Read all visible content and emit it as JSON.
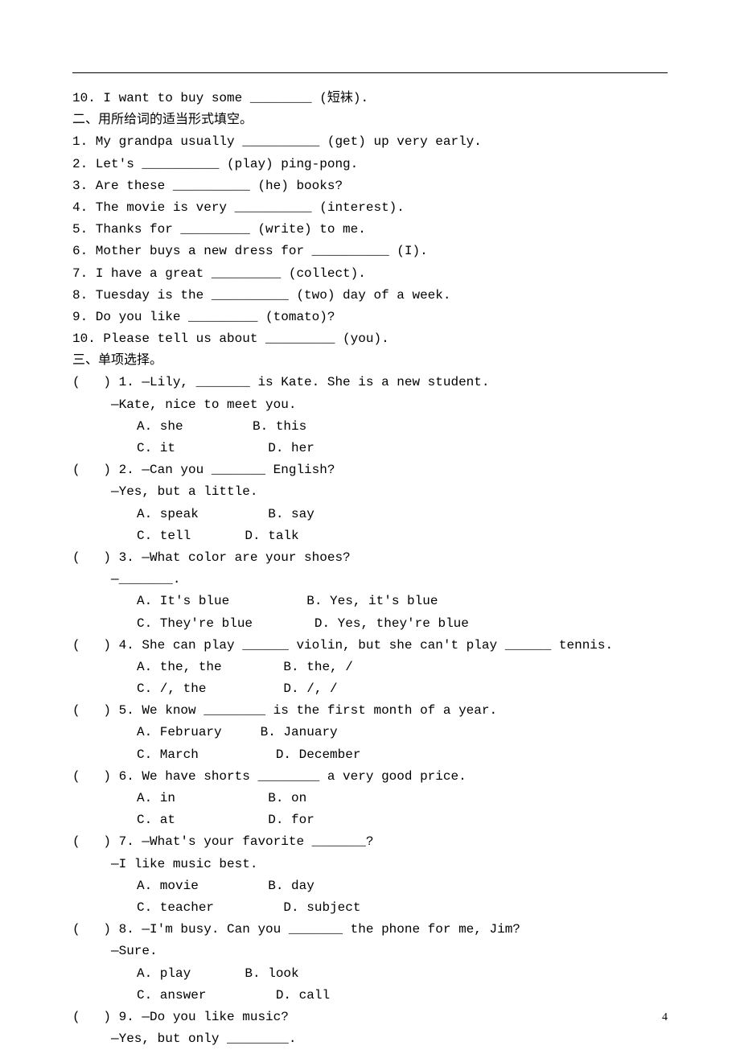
{
  "section1": {
    "q10": "10. I want to buy some ________ (短袜)."
  },
  "section2": {
    "title": "二、用所给词的适当形式填空。",
    "q1": "1. My grandpa usually __________ (get) up very early.",
    "q2": "2. Let's __________ (play) ping-pong.",
    "q3": "3. Are these __________ (he) books?",
    "q4": "4. The movie is very __________ (interest).",
    "q5": "5. Thanks for _________ (write) to me.",
    "q6": "6. Mother buys a new dress for __________ (I).",
    "q7": "7. I have a great _________ (collect).",
    "q8": "8. Tuesday is the __________ (two) day of a week.",
    "q9": "9. Do you like _________ (tomato)?",
    "q10": "10. Please tell us about _________ (you)."
  },
  "section3": {
    "title": "三、单项选择。",
    "q1": {
      "stem": "(   ) 1. —Lily, _______ is Kate. She is a new student.",
      "stem2": "—Kate, nice to meet you.",
      "row1": "A. she         B. this",
      "row2": "C. it            D. her"
    },
    "q2": {
      "stem": "(   ) 2. —Can you _______ English?",
      "stem2": "—Yes, but a little.",
      "row1": "A. speak         B. say",
      "row2": "C. tell       D. talk"
    },
    "q3": {
      "stem": "(   ) 3. —What color are your shoes?",
      "stem2": "—_______.",
      "row1": "A. It's blue          B. Yes, it's blue",
      "row2": "C. They're blue        D. Yes, they're blue"
    },
    "q4": {
      "stem": "(   ) 4. She can play ______ violin, but she can't play ______ tennis.",
      "row1": "A. the, the        B. the, /",
      "row2": "C. /, the          D. /, /"
    },
    "q5": {
      "stem": "(   ) 5. We know ________ is the first month of a year.",
      "row1": "A. February     B. January",
      "row2": "C. March          D. December"
    },
    "q6": {
      "stem": "(   ) 6. We have shorts ________ a very good price.",
      "row1": "A. in            B. on",
      "row2": "C. at            D. for"
    },
    "q7": {
      "stem": "(   ) 7. —What's your favorite _______?",
      "stem2": "—I like music best.",
      "row1": "A. movie         B. day",
      "row2": "C. teacher         D. subject"
    },
    "q8": {
      "stem": "(   ) 8. —I'm busy. Can you _______ the phone for me, Jim?",
      "stem2": "—Sure.",
      "row1": "A. play       B. look",
      "row2": "C. answer         D. call"
    },
    "q9": {
      "stem": "(   ) 9. —Do you like music?",
      "stem2": "—Yes, but only ________."
    }
  },
  "page_number": "4"
}
